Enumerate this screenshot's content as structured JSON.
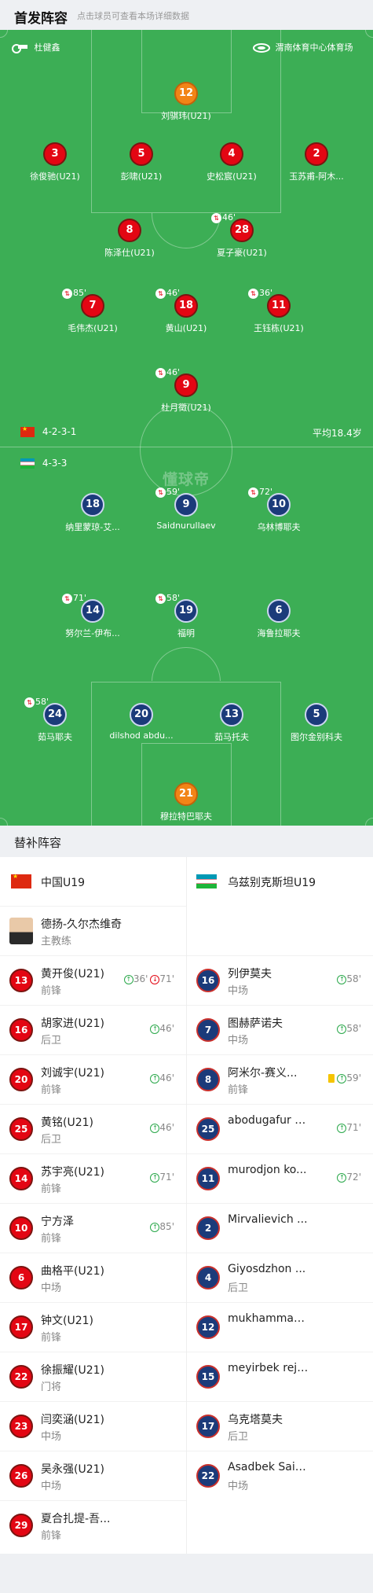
{
  "header": {
    "title": "首发阵容",
    "subtitle": "点击球员可查看本场详细数据"
  },
  "match": {
    "referee": "杜健鑫",
    "venue": "渭南体育中心体育场",
    "watermark": "懂球帝",
    "avg_age": "平均18.4岁"
  },
  "home": {
    "formation": "4-2-3-1",
    "team": "中国U19",
    "coach": {
      "name": "德扬-久尔杰维奇",
      "role": "主教练"
    }
  },
  "away": {
    "formation": "4-3-3",
    "team": "乌兹别克斯坦U19"
  },
  "home_players": [
    {
      "num": "12",
      "name": "刘骐玮(U21)",
      "color": "orange",
      "sub": ""
    },
    {
      "num": "3",
      "name": "徐俊驰(U21)",
      "color": "red",
      "sub": ""
    },
    {
      "num": "5",
      "name": "彭啸(U21)",
      "color": "red",
      "sub": ""
    },
    {
      "num": "4",
      "name": "史松宸(U21)",
      "color": "red",
      "sub": ""
    },
    {
      "num": "2",
      "name": "玉苏甫-阿木...",
      "color": "red",
      "sub": ""
    },
    {
      "num": "8",
      "name": "陈泽仕(U21)",
      "color": "red",
      "sub": ""
    },
    {
      "num": "28",
      "name": "夏子豪(U21)",
      "color": "red",
      "sub": "46'"
    },
    {
      "num": "7",
      "name": "毛伟杰(U21)",
      "color": "red",
      "sub": "85'"
    },
    {
      "num": "18",
      "name": "黄山(U21)",
      "color": "red",
      "sub": "46'"
    },
    {
      "num": "11",
      "name": "王钰栋(U21)",
      "color": "red",
      "sub": "36'"
    },
    {
      "num": "9",
      "name": "杜月徵(U21)",
      "color": "red",
      "sub": "46'"
    }
  ],
  "away_players": [
    {
      "num": "18",
      "name": "纳里蒙琼-艾...",
      "color": "blue",
      "sub": ""
    },
    {
      "num": "9",
      "name": "Saidnurullaev",
      "color": "blue",
      "sub": "59'"
    },
    {
      "num": "10",
      "name": "乌林博耶夫",
      "color": "blue",
      "sub": "72'"
    },
    {
      "num": "14",
      "name": "努尔兰-伊布...",
      "color": "blue",
      "sub": "71'"
    },
    {
      "num": "19",
      "name": "福明",
      "color": "blue",
      "sub": "58'"
    },
    {
      "num": "6",
      "name": "海鲁拉耶夫",
      "color": "blue",
      "sub": ""
    },
    {
      "num": "24",
      "name": "茹马耶夫",
      "color": "blue",
      "sub": "58'"
    },
    {
      "num": "20",
      "name": "dilshod abdu...",
      "color": "blue",
      "sub": ""
    },
    {
      "num": "13",
      "name": "茹马托夫",
      "color": "blue",
      "sub": ""
    },
    {
      "num": "5",
      "name": "图尔金别科夫",
      "color": "blue",
      "sub": ""
    },
    {
      "num": "21",
      "name": "穆拉特巴耶夫",
      "color": "orange",
      "sub": ""
    }
  ],
  "bench": {
    "title": "替补阵容",
    "home": [
      {
        "num": "13",
        "name": "黄开俊(U21)",
        "pos": "前锋",
        "ev": [
          {
            "t": "up",
            "v": "36'"
          },
          {
            "t": "down",
            "v": "71'"
          }
        ]
      },
      {
        "num": "16",
        "name": "胡家进(U21)",
        "pos": "后卫",
        "ev": [
          {
            "t": "up",
            "v": "46'"
          }
        ]
      },
      {
        "num": "20",
        "name": "刘诚宇(U21)",
        "pos": "前锋",
        "ev": [
          {
            "t": "up",
            "v": "46'"
          }
        ]
      },
      {
        "num": "25",
        "name": "黄铭(U21)",
        "pos": "后卫",
        "ev": [
          {
            "t": "up",
            "v": "46'"
          }
        ]
      },
      {
        "num": "14",
        "name": "苏宇亮(U21)",
        "pos": "前锋",
        "ev": [
          {
            "t": "up",
            "v": "71'"
          }
        ]
      },
      {
        "num": "10",
        "name": "宁方泽",
        "pos": "前锋",
        "ev": [
          {
            "t": "up",
            "v": "85'"
          }
        ]
      },
      {
        "num": "6",
        "name": "曲格平(U21)",
        "pos": "中场",
        "ev": []
      },
      {
        "num": "17",
        "name": "钟文(U21)",
        "pos": "前锋",
        "ev": []
      },
      {
        "num": "22",
        "name": "徐振耀(U21)",
        "pos": "门将",
        "ev": []
      },
      {
        "num": "23",
        "name": "闫奕涵(U21)",
        "pos": "中场",
        "ev": []
      },
      {
        "num": "26",
        "name": "吴永强(U21)",
        "pos": "中场",
        "ev": []
      },
      {
        "num": "29",
        "name": "夏合扎提-吾...",
        "pos": "前锋",
        "ev": []
      }
    ],
    "away": [
      {
        "num": "16",
        "name": "列伊莫夫",
        "pos": "中场",
        "ev": [
          {
            "t": "up",
            "v": "58'"
          }
        ]
      },
      {
        "num": "7",
        "name": "图赫萨诺夫",
        "pos": "中场",
        "ev": [
          {
            "t": "up",
            "v": "58'"
          }
        ]
      },
      {
        "num": "8",
        "name": "阿米尔-赛义...",
        "pos": "前锋",
        "ev": [
          {
            "t": "yc",
            "v": ""
          },
          {
            "t": "up",
            "v": "59'"
          }
        ]
      },
      {
        "num": "25",
        "name": "abodugafur h...",
        "pos": "",
        "ev": [
          {
            "t": "up",
            "v": "71'"
          }
        ]
      },
      {
        "num": "11",
        "name": "murodjon ko...",
        "pos": "",
        "ev": [
          {
            "t": "up",
            "v": "72'"
          }
        ]
      },
      {
        "num": "2",
        "name": "Mirvalievich ...",
        "pos": "",
        "ev": []
      },
      {
        "num": "4",
        "name": "Giyosdzhon ...",
        "pos": "后卫",
        "ev": []
      },
      {
        "num": "12",
        "name": "mukhammad...",
        "pos": "",
        "ev": []
      },
      {
        "num": "15",
        "name": "meyirbek reja...",
        "pos": "",
        "ev": []
      },
      {
        "num": "17",
        "name": "乌克塔莫夫",
        "pos": "后卫",
        "ev": []
      },
      {
        "num": "22",
        "name": "Asadbek Said...",
        "pos": "中场",
        "ev": []
      }
    ]
  }
}
